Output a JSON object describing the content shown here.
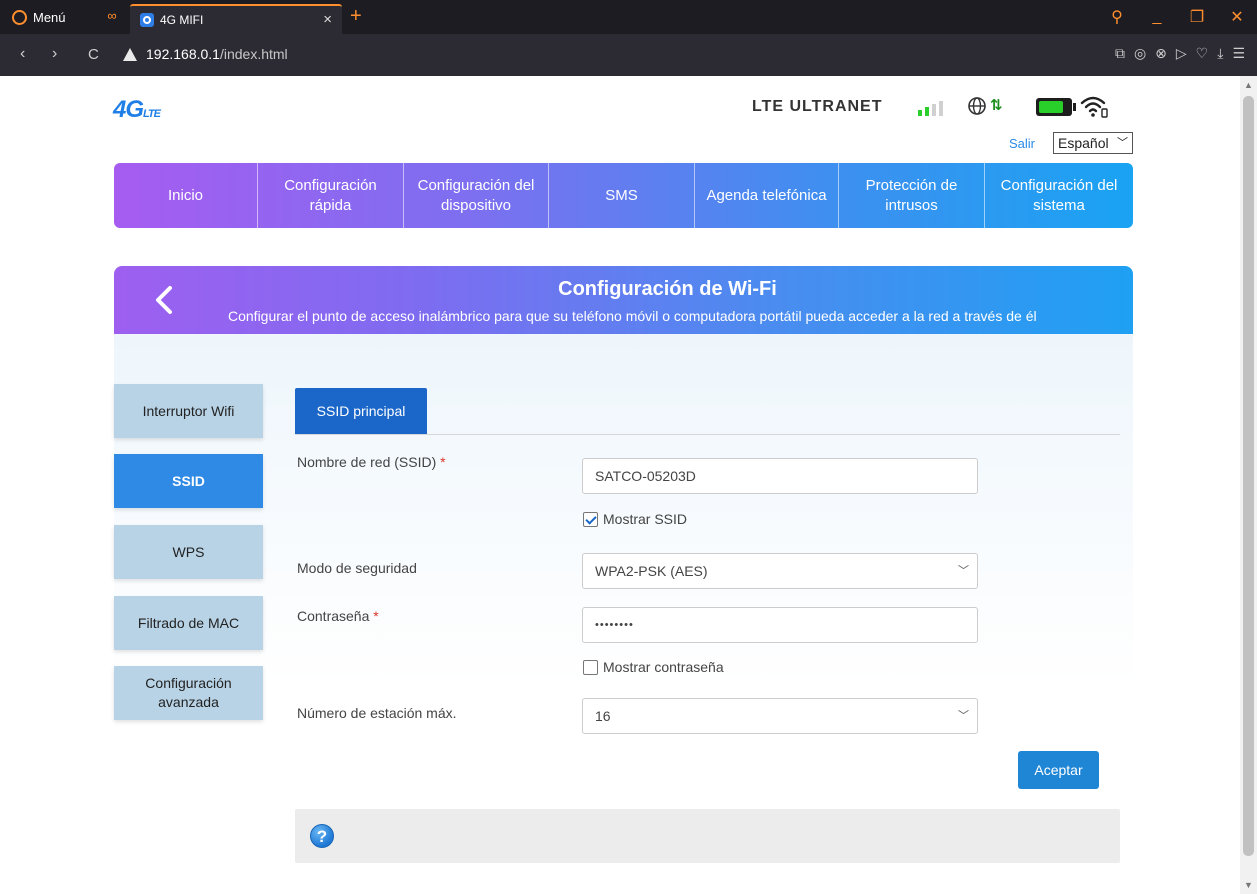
{
  "browser": {
    "menu_label": "Menú",
    "tab_title": "4G MIFI",
    "tab_close": "×",
    "new_tab": "+",
    "url_host": "192.168.0.1",
    "url_path": "/index.html",
    "controls": {
      "search": "⚲",
      "minimize": "_",
      "restore": "❐",
      "close": "✕"
    },
    "nav": {
      "back": "‹",
      "forward": "›",
      "reload": "C"
    },
    "extensions": [
      "⧉",
      "◎",
      "⊗",
      "▷",
      "♡",
      "⤓",
      "☰"
    ]
  },
  "header": {
    "logo_main": "4G",
    "logo_sub": "LTE",
    "operator": "LTE ULTRANET",
    "logout_label": "Salir",
    "language": "Español",
    "signal_bars": 2,
    "signal_bars_total": 4,
    "colors": {
      "brand": "#1f7fe6",
      "signal": "#2bcf2b",
      "battery": "#2ad02a"
    }
  },
  "nav": {
    "items": [
      {
        "label": "Inicio"
      },
      {
        "label": "Configuración rápida"
      },
      {
        "label": "Configuración del dispositivo"
      },
      {
        "label": "SMS"
      },
      {
        "label": "Agenda telefónica"
      },
      {
        "label": "Protección de intrusos"
      },
      {
        "label": "Configuración del sistema"
      }
    ]
  },
  "banner": {
    "title": "Configuración de Wi-Fi",
    "subtitle": "Configurar el punto de acceso inalámbrico para que su teléfono móvil o computadora portátil pueda acceder a la red a través de él"
  },
  "sidebar": {
    "items": [
      {
        "label": "Interruptor Wifi",
        "active": false
      },
      {
        "label": "SSID",
        "active": true
      },
      {
        "label": "WPS",
        "active": false
      },
      {
        "label": "Filtrado de MAC",
        "active": false
      },
      {
        "label": "Configuración avanzada",
        "active": false
      }
    ]
  },
  "form": {
    "subtab": "SSID principal",
    "ssid_label": "Nombre de red (SSID)",
    "ssid_value": "SATCO-05203D",
    "show_ssid_label": "Mostrar SSID",
    "show_ssid_checked": true,
    "security_label": "Modo de seguridad",
    "security_value": "WPA2-PSK (AES)",
    "password_label": "Contraseña",
    "password_value": "••••••••",
    "show_password_label": "Mostrar contraseña",
    "show_password_checked": false,
    "max_station_label": "Número de estación máx.",
    "max_station_value": "16",
    "required_mark": "*",
    "accept_label": "Aceptar"
  },
  "help": {
    "icon_text": "?"
  }
}
